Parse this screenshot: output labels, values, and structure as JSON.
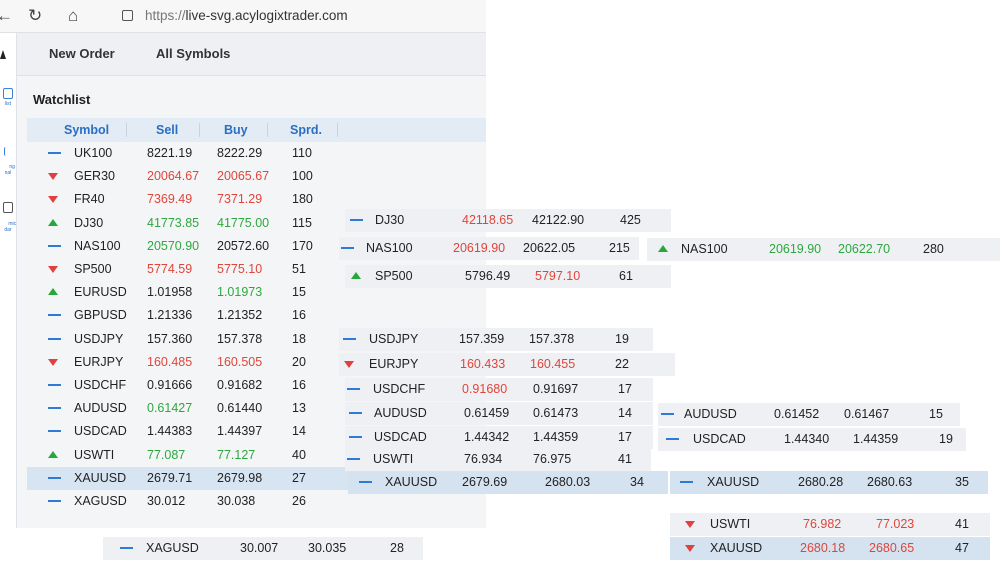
{
  "browser": {
    "url_proto": "https://",
    "url_host": "live-svg.acylogixtrader.com"
  },
  "nav": {
    "new_order": "New Order",
    "all_symbols": "All Symbols"
  },
  "rail": {
    "watchlist": "list",
    "trading_signal": "ng\nnal",
    "economic_calendar": "mic\ndar"
  },
  "watchlist": {
    "title": "Watchlist",
    "headers": {
      "symbol": "Symbol",
      "sell": "Sell",
      "buy": "Buy",
      "spread": "Sprd."
    },
    "rows": [
      {
        "dir": "flat",
        "symbol": "UK100",
        "sell": "8221.19",
        "buy": "8222.29",
        "spread": "110",
        "sell_color": "dark",
        "buy_color": "dark"
      },
      {
        "dir": "down",
        "symbol": "GER30",
        "sell": "20064.67",
        "buy": "20065.67",
        "spread": "100",
        "sell_color": "red",
        "buy_color": "red"
      },
      {
        "dir": "down",
        "symbol": "FR40",
        "sell": "7369.49",
        "buy": "7371.29",
        "spread": "180",
        "sell_color": "red",
        "buy_color": "red"
      },
      {
        "dir": "up",
        "symbol": "DJ30",
        "sell": "41773.85",
        "buy": "41775.00",
        "spread": "115",
        "sell_color": "green",
        "buy_color": "green"
      },
      {
        "dir": "flat",
        "symbol": "NAS100",
        "sell": "20570.90",
        "buy": "20572.60",
        "spread": "170",
        "sell_color": "green",
        "buy_color": "dark"
      },
      {
        "dir": "down",
        "symbol": "SP500",
        "sell": "5774.59",
        "buy": "5775.10",
        "spread": "51",
        "sell_color": "red",
        "buy_color": "red"
      },
      {
        "dir": "up",
        "symbol": "EURUSD",
        "sell": "1.01958",
        "buy": "1.01973",
        "spread": "15",
        "sell_color": "dark",
        "buy_color": "green"
      },
      {
        "dir": "flat",
        "symbol": "GBPUSD",
        "sell": "1.21336",
        "buy": "1.21352",
        "spread": "16",
        "sell_color": "dark",
        "buy_color": "dark"
      },
      {
        "dir": "flat",
        "symbol": "USDJPY",
        "sell": "157.360",
        "buy": "157.378",
        "spread": "18",
        "sell_color": "dark",
        "buy_color": "dark"
      },
      {
        "dir": "down",
        "symbol": "EURJPY",
        "sell": "160.485",
        "buy": "160.505",
        "spread": "20",
        "sell_color": "red",
        "buy_color": "red"
      },
      {
        "dir": "flat",
        "symbol": "USDCHF",
        "sell": "0.91666",
        "buy": "0.91682",
        "spread": "16",
        "sell_color": "dark",
        "buy_color": "dark"
      },
      {
        "dir": "flat",
        "symbol": "AUDUSD",
        "sell": "0.61427",
        "buy": "0.61440",
        "spread": "13",
        "sell_color": "green",
        "buy_color": "dark"
      },
      {
        "dir": "flat",
        "symbol": "USDCAD",
        "sell": "1.44383",
        "buy": "1.44397",
        "spread": "14",
        "sell_color": "dark",
        "buy_color": "dark"
      },
      {
        "dir": "up",
        "symbol": "USWTI",
        "sell": "77.087",
        "buy": "77.127",
        "spread": "40",
        "sell_color": "green",
        "buy_color": "green"
      },
      {
        "dir": "flat",
        "symbol": "XAUUSD",
        "sell": "2679.71",
        "buy": "2679.98",
        "spread": "27",
        "sell_color": "dark",
        "buy_color": "dark",
        "selected": true
      },
      {
        "dir": "flat",
        "symbol": "XAGUSD",
        "sell": "30.012",
        "buy": "30.038",
        "spread": "26",
        "sell_color": "dark",
        "buy_color": "dark"
      }
    ]
  },
  "fragments": [
    {
      "dir": "flat",
      "symbol": "DJ30",
      "sell": "42118.65",
      "buy": "42122.90",
      "spread": "425",
      "sell_color": "red",
      "buy_color": "dark"
    },
    {
      "dir": "flat",
      "symbol": "NAS100",
      "sell": "20619.90",
      "buy": "20622.05",
      "spread": "215",
      "sell_color": "red",
      "buy_color": "dark"
    },
    {
      "dir": "up",
      "symbol": "NAS100",
      "sell": "20619.90",
      "buy": "20622.70",
      "spread": "280",
      "sell_color": "green",
      "buy_color": "green"
    },
    {
      "dir": "up",
      "symbol": "SP500",
      "sell": "5796.49",
      "buy": "5797.10",
      "spread": "61",
      "sell_color": "dark",
      "buy_color": "red"
    },
    {
      "dir": "flat",
      "symbol": "USDJPY",
      "sell": "157.359",
      "buy": "157.378",
      "spread": "19",
      "sell_color": "dark",
      "buy_color": "dark"
    },
    {
      "dir": "down",
      "symbol": "EURJPY",
      "sell": "160.433",
      "buy": "160.455",
      "spread": "22",
      "sell_color": "red",
      "buy_color": "red"
    },
    {
      "dir": "flat",
      "symbol": "USDCHF",
      "sell": "0.91680",
      "buy": "0.91697",
      "spread": "17",
      "sell_color": "red",
      "buy_color": "dark"
    },
    {
      "dir": "flat",
      "symbol": "AUDUSD",
      "sell": "0.61459",
      "buy": "0.61473",
      "spread": "14",
      "sell_color": "dark",
      "buy_color": "dark"
    },
    {
      "dir": "flat",
      "symbol": "AUDUSD",
      "sell": "0.61452",
      "buy": "0.61467",
      "spread": "15",
      "sell_color": "dark",
      "buy_color": "dark"
    },
    {
      "dir": "flat",
      "symbol": "USDCAD",
      "sell": "1.44342",
      "buy": "1.44359",
      "spread": "17",
      "sell_color": "dark",
      "buy_color": "dark"
    },
    {
      "dir": "flat",
      "symbol": "USDCAD",
      "sell": "1.44340",
      "buy": "1.44359",
      "spread": "19",
      "sell_color": "dark",
      "buy_color": "dark"
    },
    {
      "dir": "flat",
      "symbol": "USWTI",
      "sell": "76.934",
      "buy": "76.975",
      "spread": "41",
      "sell_color": "dark",
      "buy_color": "dark"
    },
    {
      "dir": "flat",
      "symbol": "XAUUSD",
      "sell": "2679.69",
      "buy": "2680.03",
      "spread": "34",
      "sell_color": "dark",
      "buy_color": "dark",
      "selected": true
    },
    {
      "dir": "flat",
      "symbol": "XAUUSD",
      "sell": "2680.28",
      "buy": "2680.63",
      "spread": "35",
      "sell_color": "dark",
      "buy_color": "dark",
      "selected": true
    },
    {
      "dir": "down",
      "symbol": "USWTI",
      "sell": "76.982",
      "buy": "77.023",
      "spread": "41",
      "sell_color": "red",
      "buy_color": "red"
    },
    {
      "dir": "down",
      "symbol": "XAUUSD",
      "sell": "2680.18",
      "buy": "2680.65",
      "spread": "47",
      "sell_color": "red",
      "buy_color": "red",
      "selected": true
    },
    {
      "dir": "flat",
      "symbol": "XAGUSD",
      "sell": "30.007",
      "buy": "30.035",
      "spread": "28",
      "sell_color": "dark",
      "buy_color": "dark"
    }
  ],
  "colors": {
    "red": "#e0453a",
    "green": "#2ea83e",
    "blue": "#2f7ad6",
    "selected_row": "#d7e4f2"
  }
}
